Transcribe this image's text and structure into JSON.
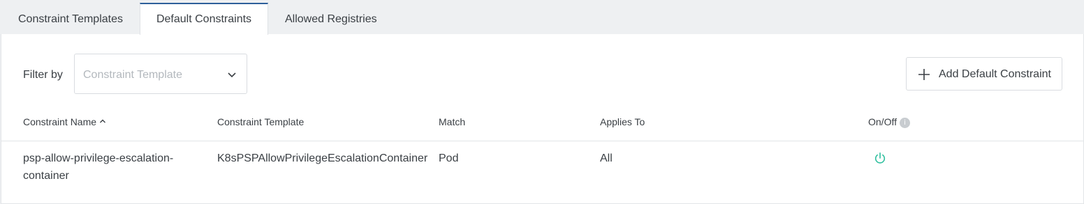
{
  "tabs": [
    {
      "label": "Constraint Templates"
    },
    {
      "label": "Default Constraints"
    },
    {
      "label": "Allowed Registries"
    }
  ],
  "active_tab": "Default Constraints",
  "filter": {
    "label": "Filter by",
    "placeholder": "Constraint Template"
  },
  "add_button": {
    "label": "Add Default Constraint"
  },
  "table": {
    "columns": [
      "Constraint Name",
      "Constraint Template",
      "Match",
      "Applies To",
      "On/Off"
    ],
    "sort_column": "Constraint Name",
    "sort_direction": "ascending",
    "info_icon": "i",
    "rows": [
      {
        "name_line1": "psp-allow-privilege-escalation-",
        "name_line2": "container",
        "template": "K8sPSPAllowPrivilegeEscalationContainer",
        "match": "Pod",
        "applies_to": "All",
        "enabled": true
      }
    ]
  },
  "colors": {
    "accent": "#2d5f9a",
    "power_on": "#2fbf9e"
  }
}
